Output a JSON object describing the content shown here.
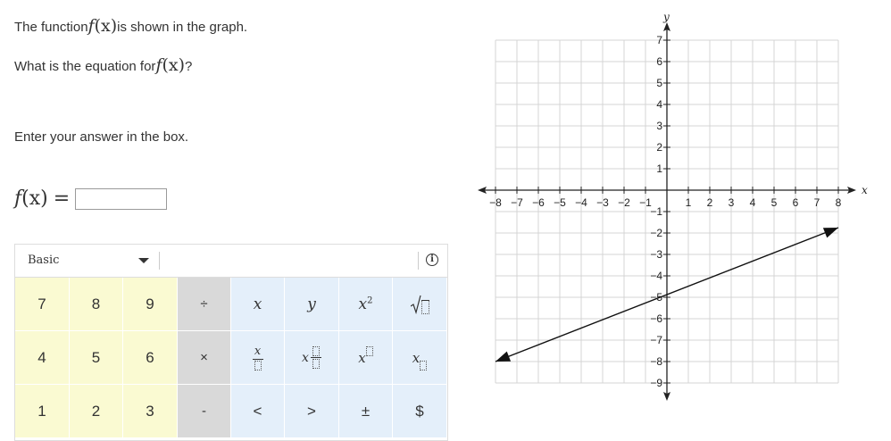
{
  "question": {
    "line1_before": "The function",
    "line1_func": "f",
    "line1_arg": "(x)",
    "line1_after": "is shown in the graph.",
    "line2_before": "What is the equation for",
    "line2_func": "f",
    "line2_arg": "(x)",
    "line2_after": "?",
    "instruction": "Enter your answer in the box."
  },
  "answer": {
    "func": "f",
    "arg": "(x)",
    "equals": "=",
    "value": ""
  },
  "keypad": {
    "mode": "Basic",
    "info_icon": "info-icon",
    "rows": [
      [
        "7",
        "8",
        "9",
        "÷",
        "x",
        "y",
        "x²",
        "√"
      ],
      [
        "4",
        "5",
        "6",
        "×",
        "x/□",
        "x □/□",
        "x^□",
        "x_□"
      ],
      [
        "1",
        "2",
        "3",
        "-",
        "<",
        ">",
        "±",
        "$"
      ]
    ]
  },
  "graph": {
    "x_label": "x",
    "y_label": "y",
    "x_ticks": [
      -8,
      -7,
      -6,
      -5,
      -4,
      -3,
      -2,
      -1,
      1,
      2,
      3,
      4,
      5,
      6,
      7,
      8
    ],
    "y_ticks": [
      7,
      6,
      5,
      4,
      3,
      2,
      1,
      -1,
      -2,
      -3,
      -4,
      -5,
      -6,
      -7,
      -8,
      -9
    ],
    "range_x": [
      -8,
      8
    ],
    "range_y": [
      -9,
      7
    ],
    "grid": true,
    "line": {
      "points": [
        [
          -8,
          -8
        ],
        [
          8,
          -1.75
        ]
      ],
      "arrows": "both",
      "passes_through": [
        [
          0,
          -5
        ]
      ]
    }
  }
}
